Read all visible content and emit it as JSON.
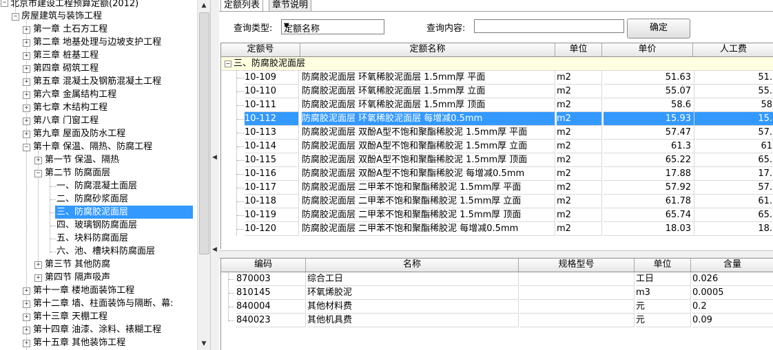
{
  "tree": {
    "root": "北京市建设工程预算定额(2012)",
    "section": "房屋建筑与装饰工程",
    "chapters": [
      "第一章 土石方工程",
      "第二章 地基处理与边坡支护工程",
      "第三章 桩基工程",
      "第四章 砌筑工程",
      "第五章 混凝土及钢筋混凝土工程",
      "第六章 金属结构工程",
      "第七章 木结构工程",
      "第八章 门窗工程",
      "第九章 屋面及防水工程",
      "第十章 保温、隔热、防腐工程"
    ],
    "ch10_sections": [
      "第一节 保温、隔热",
      "第二节 防腐面层"
    ],
    "sec2_items": [
      "一、防腐混凝土面层",
      "二、防腐砂浆面层",
      "三、防腐胶泥面层",
      "四、玻璃钢防腐面层",
      "五、块料防腐面层",
      "六、池、槽块料防腐面层"
    ],
    "ch10_more": [
      "第三节 其他防腐",
      "第四节 隔声吸声"
    ],
    "chapters_after": [
      "第十一章 楼地面装饰工程",
      "第十二章 墙、柱面装饰与隔断、幕:",
      "第十三章 天棚工程",
      "第十四章 油漆、涂料、裱糊工程",
      "第十五章 其他装饰工程"
    ]
  },
  "tabs": [
    "定额列表",
    "章节说明"
  ],
  "query": {
    "type_label": "查询类型:",
    "type_value": "定额名称",
    "content_label": "查询内容:",
    "content_value": "",
    "ok_label": "确定"
  },
  "upper_grid": {
    "columns": [
      "定额号",
      "定额名称",
      "单位",
      "单价",
      "人工费"
    ],
    "group": "三、防腐胶泥面层",
    "rows": [
      [
        "10-109",
        "防腐胶泥面层 环氧稀胶泥面层 1.5mm厚 平面",
        "m2",
        "51.63",
        "51."
      ],
      [
        "10-110",
        "防腐胶泥面层 环氧稀胶泥面层 1.5mm厚 立面",
        "m2",
        "55.07",
        "55."
      ],
      [
        "10-111",
        "防腐胶泥面层 环氧稀胶泥面层 1.5mm厚 顶面",
        "m2",
        "58.6",
        "58"
      ],
      [
        "10-112",
        "防腐胶泥面层 环氧稀胶泥面层 每增减0.5mm",
        "m2",
        "15.93",
        "15."
      ],
      [
        "10-113",
        "防腐胶泥面层 双酚A型不饱和聚酯稀胶泥 1.5mm厚 平面",
        "m2",
        "57.47",
        "57."
      ],
      [
        "10-114",
        "防腐胶泥面层 双酚A型不饱和聚酯稀胶泥 1.5mm厚 立面",
        "m2",
        "61.3",
        "61"
      ],
      [
        "10-115",
        "防腐胶泥面层 双酚A型不饱和聚酯稀胶泥 1.5mm厚 顶面",
        "m2",
        "65.22",
        "65."
      ],
      [
        "10-116",
        "防腐胶泥面层 双酚A型不饱和聚酯稀胶泥 每增减0.5mm",
        "m2",
        "17.88",
        "17."
      ],
      [
        "10-117",
        "防腐胶泥面层 二甲苯不饱和聚酯稀胶泥 1.5mm厚 平面",
        "m2",
        "57.92",
        "57."
      ],
      [
        "10-118",
        "防腐胶泥面层 二甲苯不饱和聚酯稀胶泥 1.5mm厚 立面",
        "m2",
        "61.78",
        "61."
      ],
      [
        "10-119",
        "防腐胶泥面层 二甲苯不饱和聚酯稀胶泥 1.5mm厚 顶面",
        "m2",
        "65.74",
        "65."
      ],
      [
        "10-120",
        "防腐胶泥面层 二甲苯不饱和聚酯稀胶泥 每增减0.5mm",
        "m2",
        "18.03",
        "18."
      ]
    ]
  },
  "lower_grid": {
    "columns": [
      "编码",
      "名称",
      "规格型号",
      "单位",
      "含量"
    ],
    "rows": [
      [
        "870003",
        "综合工日",
        "",
        "工日",
        "0.026"
      ],
      [
        "810145",
        "环氧烯胶泥",
        "",
        "m3",
        "0.0005"
      ],
      [
        "840004",
        "其他材料费",
        "",
        "元",
        "0.2"
      ],
      [
        "840023",
        "其他机具费",
        "",
        "元",
        "0.09"
      ]
    ]
  },
  "icons": {
    "expand": "plus-box-icon",
    "collapse": "minus-box-icon",
    "scroll_up": "arrow-up-icon",
    "scroll_down": "arrow-down-icon"
  }
}
